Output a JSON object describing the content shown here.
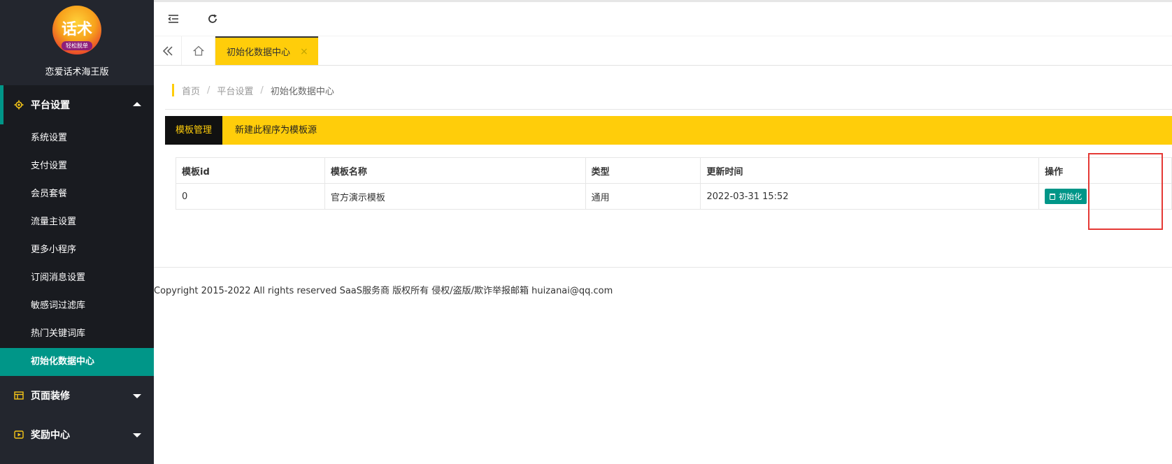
{
  "sidebar": {
    "logo": {
      "main": "话术",
      "sub": "轻松脱单"
    },
    "app_name": "恋爱话术海王版",
    "groups": [
      {
        "label": "平台设置",
        "icon": "gear-icon",
        "expanded": true,
        "items": [
          {
            "label": "系统设置"
          },
          {
            "label": "支付设置"
          },
          {
            "label": "会员套餐"
          },
          {
            "label": "流量主设置"
          },
          {
            "label": "更多小程序"
          },
          {
            "label": "订阅消息设置"
          },
          {
            "label": "敏感词过滤库"
          },
          {
            "label": "热门关键词库"
          },
          {
            "label": "初始化数据中心",
            "active": true
          }
        ]
      },
      {
        "label": "页面装修",
        "icon": "layout-icon",
        "expanded": false
      },
      {
        "label": "奖励中心",
        "icon": "play-icon",
        "expanded": false
      }
    ]
  },
  "header": {
    "menu_toggle_icon": "menu-collapse-icon",
    "refresh_icon": "refresh-icon"
  },
  "tabs": {
    "nav_icon": "double-chevron-left-icon",
    "home_icon": "home-icon",
    "active_label": "初始化数据中心",
    "close_glyph": "×"
  },
  "breadcrumb": {
    "items": [
      "首页",
      "平台设置",
      "初始化数据中心"
    ],
    "separator": "/"
  },
  "toolbar": {
    "active_label": "模板管理",
    "secondary_label": "新建此程序为模板源"
  },
  "table": {
    "columns": [
      "模板id",
      "模板名称",
      "类型",
      "更新时间",
      "操作"
    ],
    "rows": [
      {
        "id": "0",
        "name": "官方演示模板",
        "type": "通用",
        "updated": "2022-03-31 15:52",
        "action": "初始化"
      }
    ]
  },
  "footer": {
    "text": "Copyright 2015-2022 All rights reserved SaaS服务商 版权所有 侵权/盗版/欺诈举报邮箱 huizanai@qq.com"
  },
  "colors": {
    "sidebar_bg": "#23262e",
    "accent_teal": "#009688",
    "accent_yellow": "#ffcd0a",
    "highlight_red": "#e53935"
  }
}
